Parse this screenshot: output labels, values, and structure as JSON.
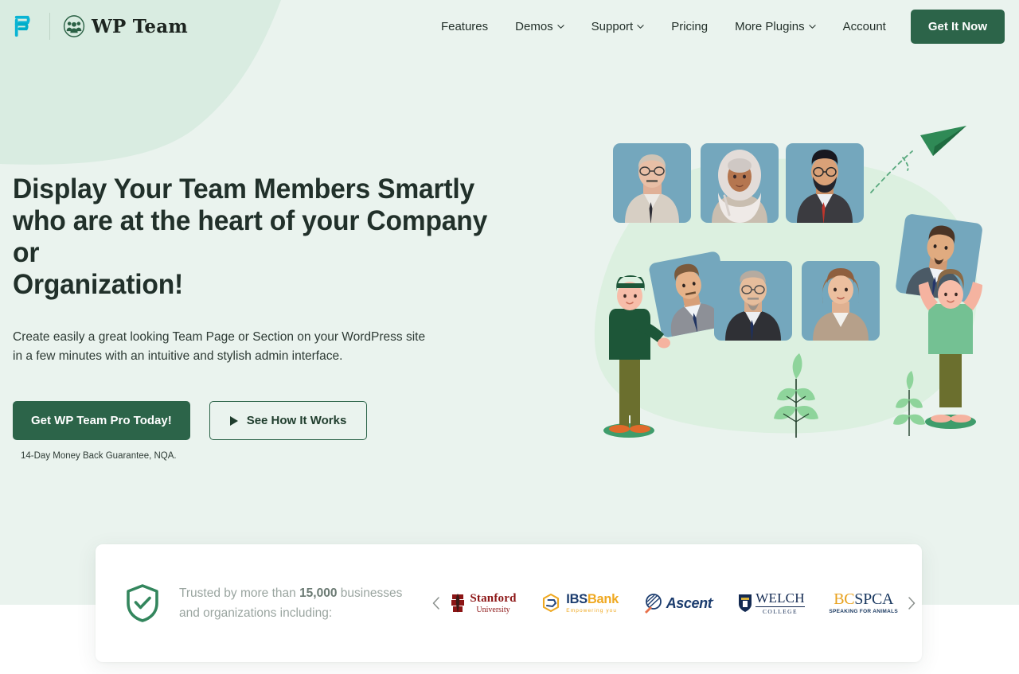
{
  "theme": {
    "hero_bg": "#eaf3ee",
    "hero_curve": "#d7ead d",
    "brand_green": "#2c6449",
    "heading_color": "#21302a",
    "muted_text": "#9aa5a0",
    "page_bg": "#ffffff"
  },
  "header": {
    "brand": {
      "mark_icon": "pressmaximum-p-logo-icon",
      "badge_icon": "team-people-circle-icon",
      "name": "WP Team"
    },
    "nav": [
      {
        "label": "Features",
        "has_caret": false,
        "icon": ""
      },
      {
        "label": "Demos",
        "has_caret": true,
        "icon": "chevron-down-icon"
      },
      {
        "label": "Support",
        "has_caret": true,
        "icon": "chevron-down-icon"
      },
      {
        "label": "Pricing",
        "has_caret": false,
        "icon": ""
      },
      {
        "label": "More Plugins",
        "has_caret": true,
        "icon": "chevron-down-icon"
      },
      {
        "label": "Account",
        "has_caret": false,
        "icon": ""
      }
    ],
    "cta_label": "Get It Now"
  },
  "hero": {
    "headline_line1": "Display Your Team Members Smartly",
    "headline_line2": "who are at the heart of your Company or",
    "headline_line3": "Organization!",
    "subhead_line1": "Create easily a great looking Team Page or Section on your WordPress site",
    "subhead_line2": "in a few minutes with an intuitive and stylish admin interface.",
    "primary_button": "Get WP Team Pro Today!",
    "secondary_button": "See How It Works",
    "secondary_icon": "play-triangle-icon",
    "guarantee": "14-Day Money Back Guarantee, NQA.",
    "illustration": {
      "name": "team-members-grid-illustration",
      "paper_plane_icon": "paper-plane-icon",
      "cards": [
        {
          "id": "card-1",
          "person": "older-man-glasses-mustache-beige-suit"
        },
        {
          "id": "card-2",
          "person": "woman-white-hijab"
        },
        {
          "id": "card-3",
          "person": "man-glasses-beard-red-tie"
        },
        {
          "id": "card-4",
          "person": "man-beard-navy-tie-tilted"
        },
        {
          "id": "card-5",
          "person": "man-mustache-navy-tie-tilted"
        },
        {
          "id": "card-6",
          "person": "bald-man-glasses-beard-navy-tie"
        },
        {
          "id": "card-7",
          "person": "woman-brown-hair-tan-blazer"
        }
      ],
      "figures": [
        {
          "id": "figure-left",
          "desc": "person-holding-card-green-sweater"
        },
        {
          "id": "figure-right",
          "desc": "person-lifting-card-green-shirt"
        }
      ],
      "plants": [
        "plant-center",
        "plant-right"
      ]
    }
  },
  "trusted": {
    "shield_icon": "shield-check-icon",
    "text_before": "Trusted by more than ",
    "count": "15,000",
    "text_after": " businesses",
    "text_line2": "and organizations including:",
    "prev_icon": "chevron-left-icon",
    "next_icon": "chevron-right-icon",
    "logos": [
      {
        "id": "stanford",
        "name": "Stanford University",
        "line1": "Stanford",
        "line2": "University",
        "color": "#8c1515"
      },
      {
        "id": "ibsbank",
        "name": "IBSBank",
        "part1": "IBS",
        "part2": "Bank",
        "tagline": "Empowering you",
        "color": "#1b3c6e",
        "accent": "#efa820"
      },
      {
        "id": "ascent",
        "name": "Ascent",
        "line1": "Ascent",
        "mark": "·",
        "color": "#1b3c6e"
      },
      {
        "id": "welch",
        "name": "Welch College",
        "line1": "WELCH",
        "line2": "COLLEGE",
        "color": "#132a52"
      },
      {
        "id": "bcspca",
        "name": "BCSPCA",
        "part1": "BC",
        "part2": "SPCA",
        "tagline": "SPEAKING FOR ANIMALS",
        "color": "#18375f",
        "accent": "#e8a11c"
      }
    ]
  }
}
